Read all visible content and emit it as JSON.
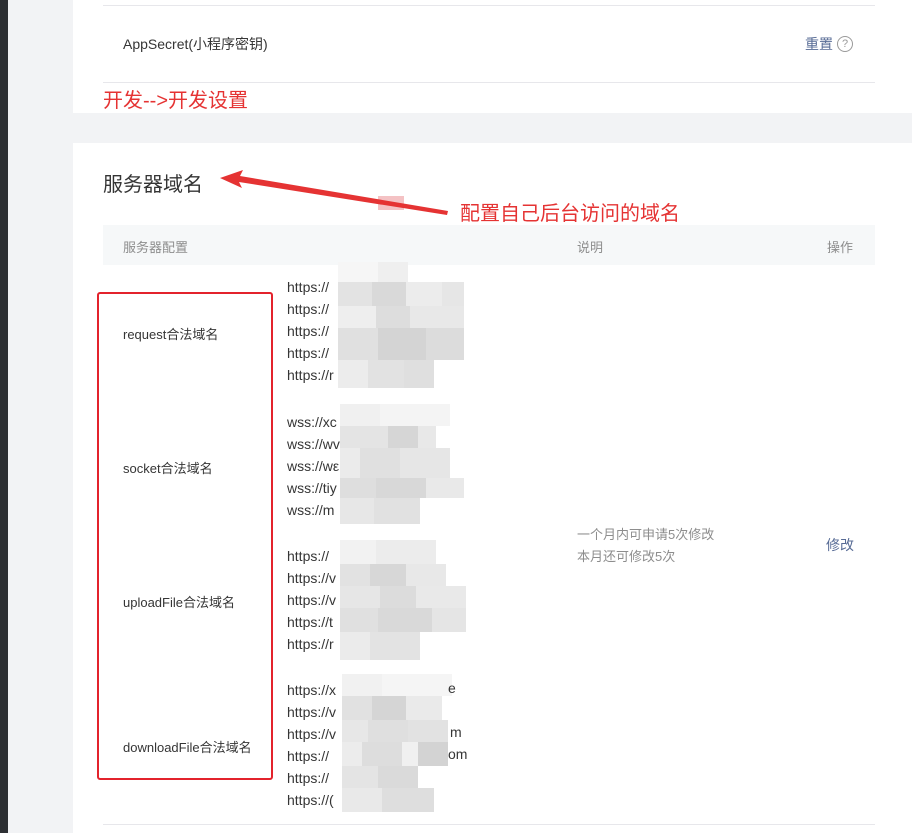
{
  "appsecret": {
    "label": "AppSecret(小程序密钥)",
    "reset_label": "重置",
    "help_icon": "?"
  },
  "annotations": {
    "dev_settings": "开发-->开发设置",
    "domain_hint": "配置自己后台访问的域名",
    "annotation_color": "#e53333"
  },
  "server_domain": {
    "title": "服务器域名",
    "headers": {
      "config": "服务器配置",
      "description": "说明",
      "action": "操作"
    },
    "groups": [
      {
        "label": "request合法域名",
        "urls": [
          "https://",
          "https://",
          "https://",
          "https://",
          "https://r"
        ]
      },
      {
        "label": "socket合法域名",
        "urls": [
          "wss://xc",
          "wss://wv",
          "wss://wε",
          "wss://tiy",
          "wss://m"
        ]
      },
      {
        "label": "uploadFile合法域名",
        "urls": [
          "https://",
          "https://v",
          "https://v",
          "https://t",
          "https://r"
        ]
      },
      {
        "label": "downloadFile合法域名",
        "urls": [
          "https://x",
          "https://v",
          "https://v",
          "https://",
          "https://",
          "https://("
        ]
      }
    ],
    "url_tails": [
      "e",
      "m",
      "om"
    ],
    "description_lines": [
      "一个月内可申请5次修改",
      "本月还可修改5次"
    ],
    "modify_label": "修改",
    "link_color": "#576b95"
  }
}
